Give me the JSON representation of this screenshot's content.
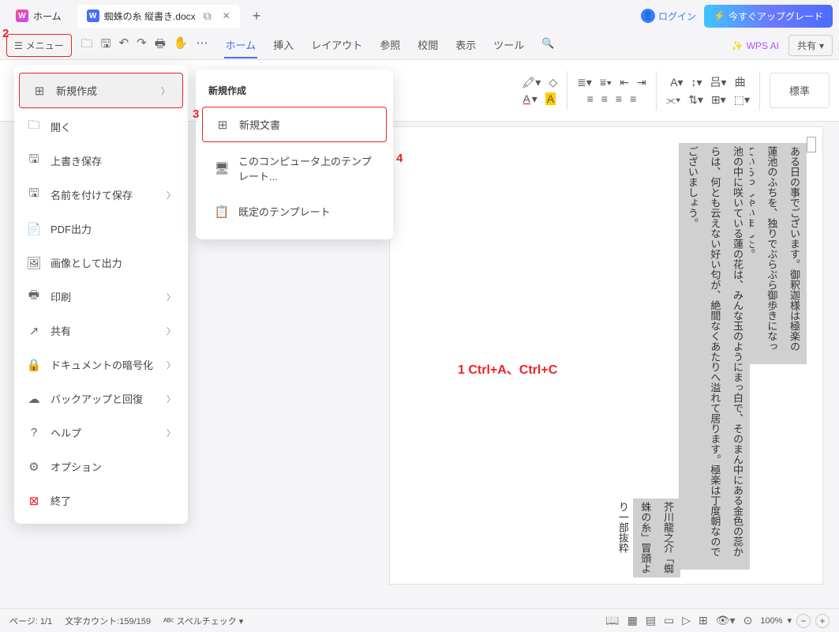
{
  "titlebar": {
    "home_tab": "ホーム",
    "doc_tab": "蜘蛛の糸 縦書き.docx",
    "login": "ログイン",
    "upgrade": "今すぐアップグレード"
  },
  "toolbar": {
    "menu_label": "メニュー",
    "tabs": [
      "ホーム",
      "挿入",
      "レイアウト",
      "参照",
      "校閲",
      "表示",
      "ツール"
    ],
    "wps_ai": "WPS AI",
    "share": "共有"
  },
  "ribbon": {
    "style_normal": "標準"
  },
  "menu": {
    "items": [
      {
        "icon": "new",
        "label": "新規作成",
        "chevron": true,
        "highlight": true
      },
      {
        "icon": "open",
        "label": "開く"
      },
      {
        "icon": "save",
        "label": "上書き保存"
      },
      {
        "icon": "saveas",
        "label": "名前を付けて保存",
        "chevron": true
      },
      {
        "icon": "pdf",
        "label": "PDF出力"
      },
      {
        "icon": "image",
        "label": "画像として出力"
      },
      {
        "icon": "print",
        "label": "印刷",
        "chevron": true
      },
      {
        "icon": "share",
        "label": "共有",
        "chevron": true
      },
      {
        "icon": "encrypt",
        "label": "ドキュメントの暗号化",
        "chevron": true
      },
      {
        "icon": "backup",
        "label": "バックアップと回復",
        "chevron": true
      },
      {
        "icon": "help",
        "label": "ヘルプ",
        "chevron": true
      },
      {
        "icon": "options",
        "label": "オプション"
      },
      {
        "icon": "exit",
        "label": "終了"
      }
    ]
  },
  "submenu": {
    "title": "新規作成",
    "items": [
      {
        "icon": "newdoc",
        "label": "新規文書",
        "highlight": true
      },
      {
        "icon": "template-pc",
        "label": "このコンピュータ上のテンプレート..."
      },
      {
        "icon": "template-default",
        "label": "既定のテンプレート"
      }
    ]
  },
  "document": {
    "col1": "ある日の事でございます。御釈迦様は極楽の蓮池のふちを、独りでぶらぶら御歩きになっていらっしゃいました。",
    "col2": "池の中に咲いている蓮の花は、みんな玉のようにまっ白で、そのまん中にある金色の蕊からは、何とも云えない好い匂が、絶間なくあたりへ溢れて居ります。極楽は丁度朝なのでございましょう。",
    "col3": "芥川龍之介「蜘蛛の糸」冒頭より一部抜粋"
  },
  "annotations": {
    "a1": "2",
    "a2": "3",
    "a3": "4",
    "a4": "1 Ctrl+A、Ctrl+C"
  },
  "statusbar": {
    "page": "ページ: 1/1",
    "wordcount": "文字カウント:159/159",
    "spellcheck": "スペルチェック",
    "zoom": "100%"
  }
}
